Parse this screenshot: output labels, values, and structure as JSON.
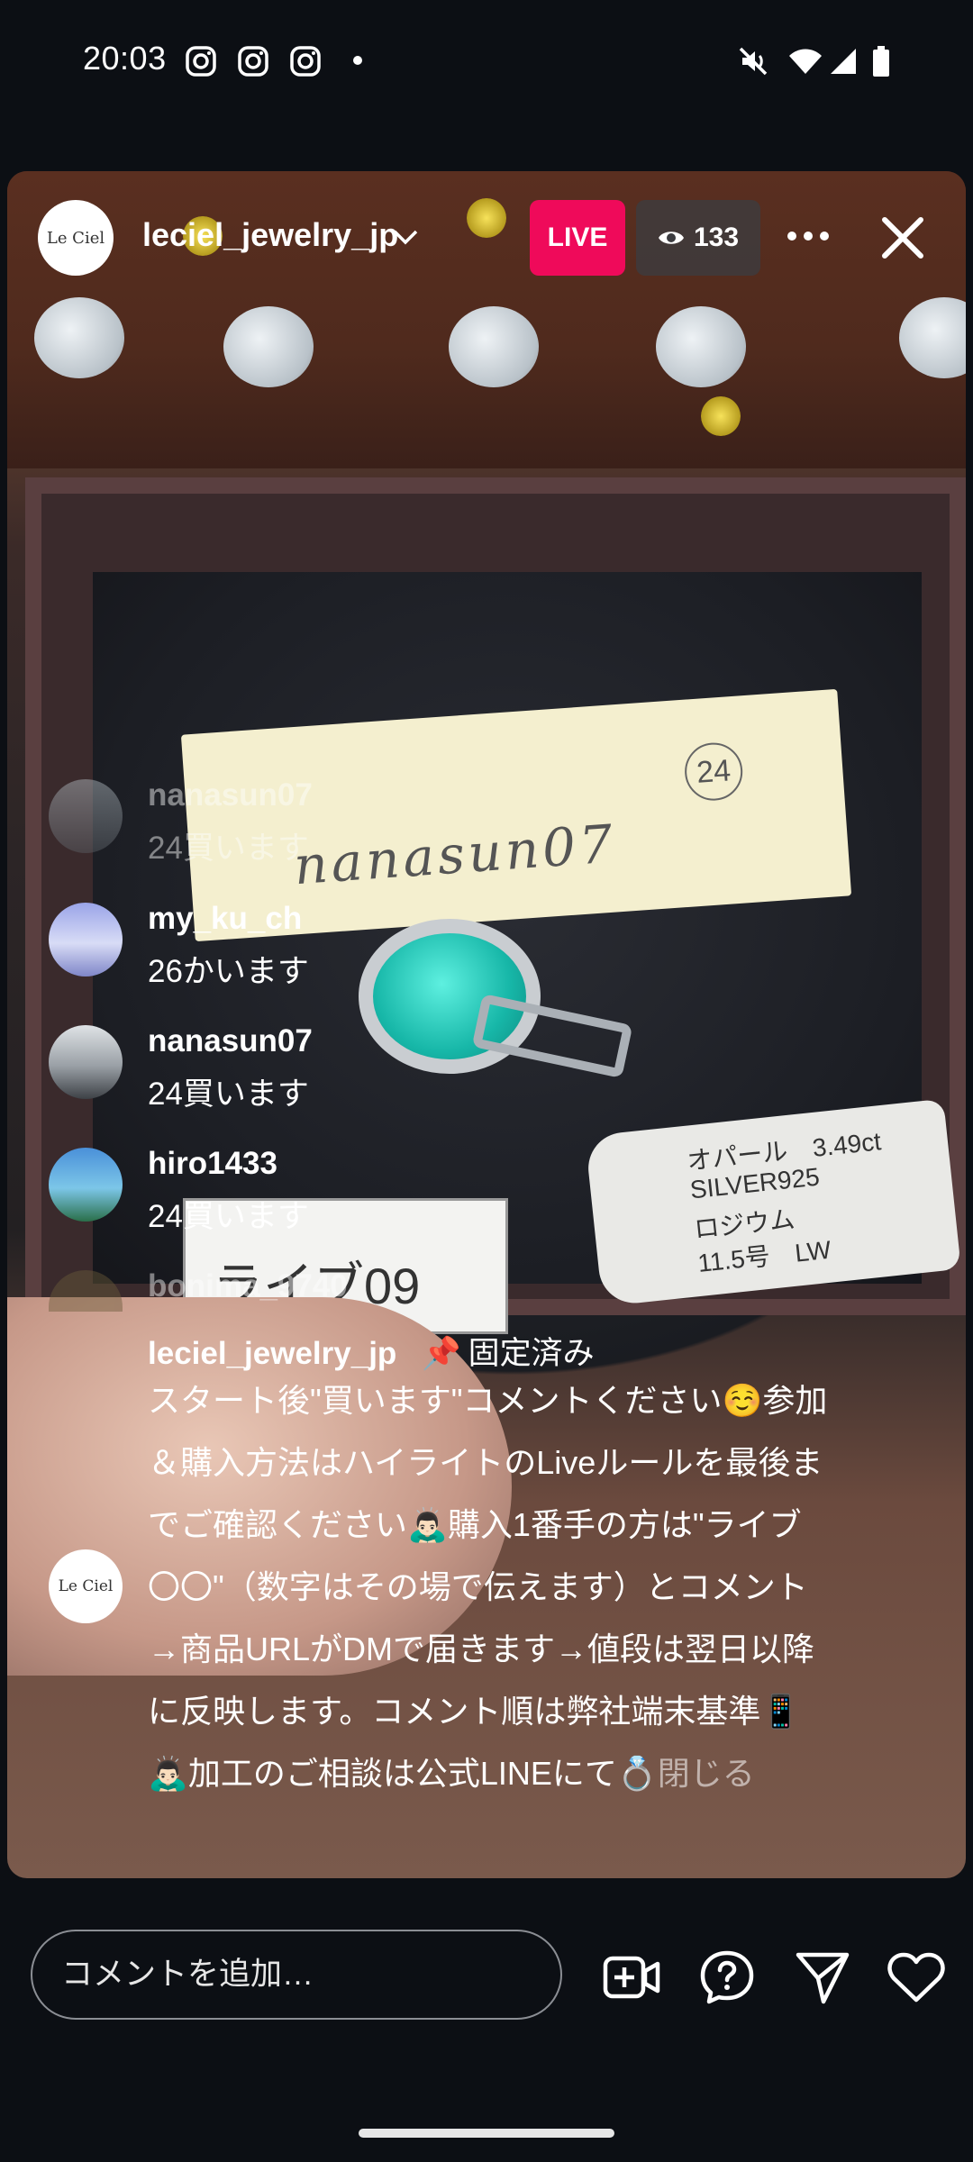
{
  "status_bar": {
    "time": "20:03",
    "left_icons": [
      "instagram-icon",
      "instagram-icon",
      "instagram-icon"
    ],
    "right_icons": [
      "mute-icon",
      "wifi-icon",
      "signal-icon",
      "battery-icon"
    ]
  },
  "header": {
    "avatar_text": "Le Ciel",
    "username": "leciel_jewelry_jp",
    "live_label": "LIVE",
    "viewer_count": "133"
  },
  "video": {
    "note_text": "nanasun07",
    "note_number": "24",
    "tag_lines": [
      "オパール　3.49ct",
      "SILVER925",
      "ロジウム",
      "11.5号　LW"
    ],
    "label_text": "ライブ09"
  },
  "comments": [
    {
      "username": "nanasun07",
      "text": "24買います",
      "faded": true
    },
    {
      "username": "my_ku_ch",
      "text": "26かいます",
      "faded": false
    },
    {
      "username": "nanasun07",
      "text": "24買います",
      "faded": false
    },
    {
      "username": "hiro1433",
      "text": "24買います",
      "faded": false
    },
    {
      "username": "bonima_9740",
      "text": "",
      "faded": true
    }
  ],
  "pinned": {
    "avatar_text": "Le Ciel",
    "username": "leciel_jewelry_jp",
    "pin_label": "固定済み",
    "body": "スタート後\"買います\"コメントください☺️参加＆購入方法はハイライトのLiveルールを最後までご確認ください🙇🏻‍♂️購入1番手の方は\"ライブ〇〇\"（数字はその場で伝えます）とコメント→商品URLがDMで届きます→値段は翌日以降に反映します。コメント順は弊社端末基準📱🙇🏻‍♂️加工のご相談は公式LINEにて💍",
    "close_label": "閉じる"
  },
  "bottom_bar": {
    "comment_placeholder": "コメントを追加…",
    "icons": [
      "add-video-icon",
      "question-icon",
      "send-icon",
      "heart-icon"
    ]
  },
  "colors": {
    "live_badge": "#ef0a5a",
    "background": "#0c0f14"
  }
}
